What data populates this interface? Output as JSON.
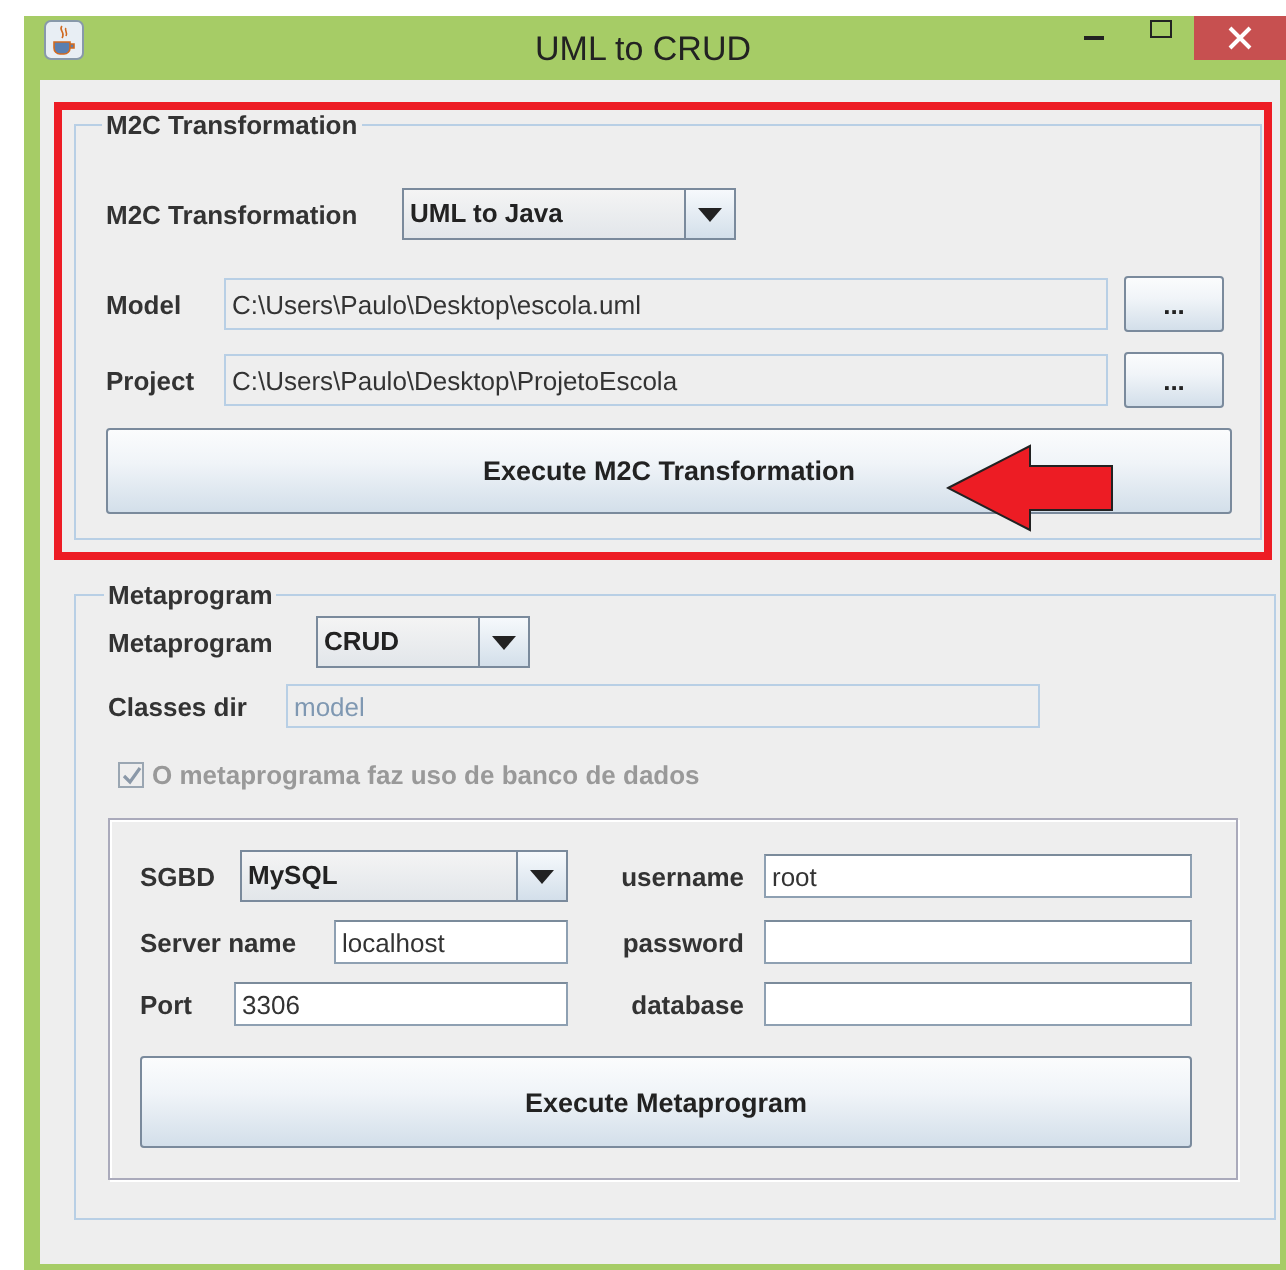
{
  "window": {
    "title": "UML to CRUD"
  },
  "m2c": {
    "title": "M2C Transformation",
    "highlighted": true,
    "transformation": {
      "label": "M2C Transformation",
      "value": "UML to Java"
    },
    "model": {
      "label": "Model",
      "value": "C:\\Users\\Paulo\\Desktop\\escola.uml",
      "button": "..."
    },
    "project": {
      "label": "Project",
      "value": "C:\\Users\\Paulo\\Desktop\\ProjetoEscola",
      "button": "..."
    },
    "execute_button": "Execute M2C Transformation"
  },
  "metaprogram": {
    "title": "Metaprogram",
    "metaprogram": {
      "label": "Metaprogram",
      "value": "CRUD"
    },
    "classes_dir": {
      "label": "Classes dir",
      "value": "model",
      "disabled": true
    },
    "uses_database": {
      "label": "O metaprograma faz uso de banco de dados",
      "checked": true,
      "disabled": true
    },
    "database": {
      "sgbd": {
        "label": "SGBD",
        "value": "MySQL"
      },
      "server_name": {
        "label": "Server name",
        "value": "localhost"
      },
      "port": {
        "label": "Port",
        "value": "3306"
      },
      "username": {
        "label": "username",
        "value": "root"
      },
      "password": {
        "label": "password"
      },
      "database": {
        "label": "database"
      }
    },
    "execute_button": "Execute Metaprogram"
  }
}
